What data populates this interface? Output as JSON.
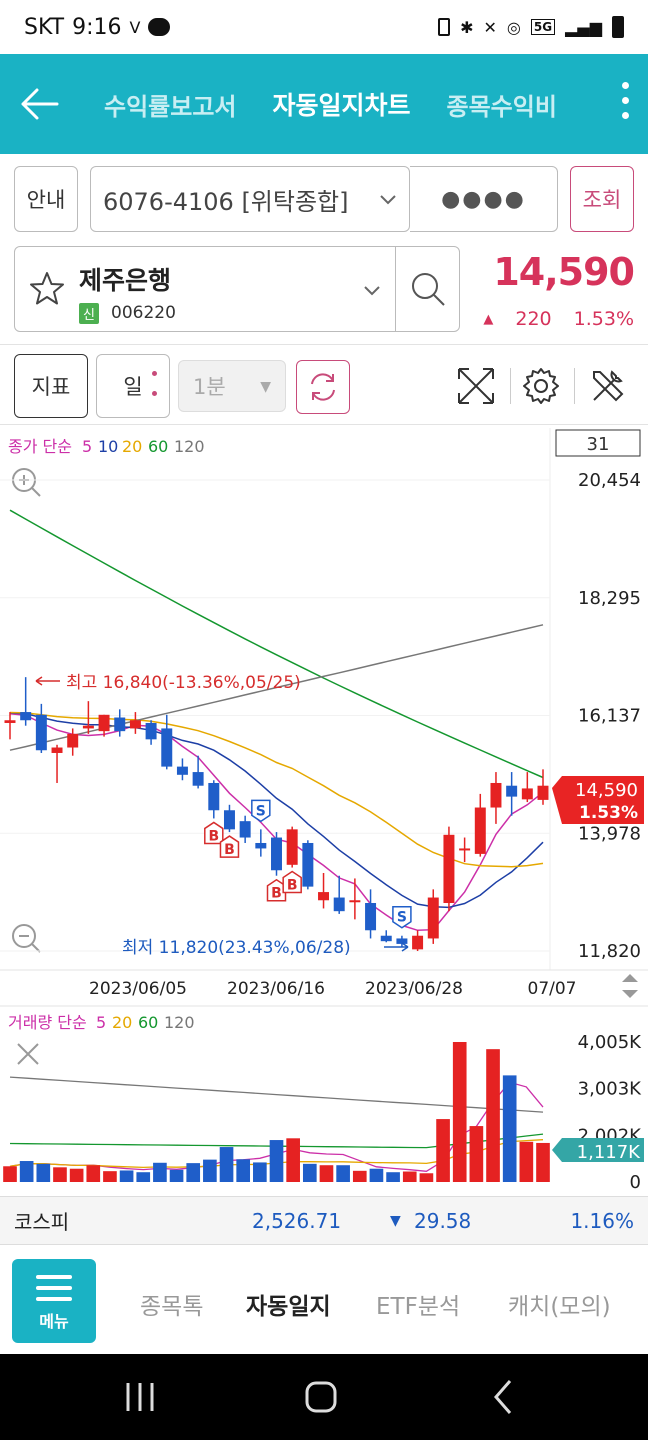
{
  "status": {
    "carrier": "SKT",
    "time": "9:16",
    "network": "5G"
  },
  "nav": {
    "tabs": [
      "수익률보고서",
      "자동일지차트",
      "종목수익비"
    ],
    "active_index": 1
  },
  "account": {
    "info_label": "안내",
    "account_number": "6076-4106 [위탁종합]",
    "password_mask": "●●●●",
    "query_label": "조회"
  },
  "stock": {
    "name": "제주은행",
    "badge": "신",
    "code": "006220",
    "price": "14,590",
    "change": "220",
    "change_pct": "1.53%"
  },
  "toolbar": {
    "indicator_label": "지표",
    "period_label": "일",
    "interval_label": "1분",
    "count": "31"
  },
  "chart_data": {
    "type": "candlestick",
    "legend": {
      "prefix": "종가 단순",
      "periods": [
        "5",
        "10",
        "20",
        "60",
        "120"
      ],
      "colors": [
        "#cc2fa8",
        "#1d3fa6",
        "#e5a800",
        "#14972f",
        "#777777"
      ]
    },
    "y_ticks": [
      "20,454",
      "18,295",
      "16,137",
      "13,978",
      "11,820"
    ],
    "ylim": [
      11820,
      20454
    ],
    "x_ticks": [
      "2023/06/05",
      "2023/06/16",
      "2023/06/28",
      "07/07"
    ],
    "high_label": "최고 16,840(-13.36%,05/25)",
    "low_label": "최저 11,820(23.43%,06/28)",
    "last_price": "14,590",
    "last_pct": "1.53%",
    "candles": [
      {
        "o": 16000,
        "h": 16200,
        "l": 15700,
        "c": 16050
      },
      {
        "o": 16200,
        "h": 16840,
        "l": 15950,
        "c": 16050
      },
      {
        "o": 16150,
        "h": 16350,
        "l": 15450,
        "c": 15500
      },
      {
        "o": 15450,
        "h": 15600,
        "l": 14900,
        "c": 15550
      },
      {
        "o": 15550,
        "h": 15900,
        "l": 15400,
        "c": 15800
      },
      {
        "o": 15900,
        "h": 16400,
        "l": 15800,
        "c": 15950
      },
      {
        "o": 15850,
        "h": 16150,
        "l": 15750,
        "c": 16150
      },
      {
        "o": 16100,
        "h": 16250,
        "l": 15750,
        "c": 15850
      },
      {
        "o": 15900,
        "h": 16200,
        "l": 15800,
        "c": 16050
      },
      {
        "o": 16000,
        "h": 16050,
        "l": 15600,
        "c": 15700
      },
      {
        "o": 15900,
        "h": 16150,
        "l": 15150,
        "c": 15200
      },
      {
        "o": 15200,
        "h": 15350,
        "l": 14950,
        "c": 15050
      },
      {
        "o": 15100,
        "h": 15400,
        "l": 14800,
        "c": 14850
      },
      {
        "o": 14900,
        "h": 14950,
        "l": 14250,
        "c": 14400
      },
      {
        "o": 14400,
        "h": 14500,
        "l": 14000,
        "c": 14050
      },
      {
        "o": 14200,
        "h": 14300,
        "l": 13800,
        "c": 13900
      },
      {
        "o": 13800,
        "h": 14050,
        "l": 13550,
        "c": 13700
      },
      {
        "o": 13900,
        "h": 14000,
        "l": 13200,
        "c": 13300
      },
      {
        "o": 13400,
        "h": 14100,
        "l": 13350,
        "c": 14050
      },
      {
        "o": 13800,
        "h": 13850,
        "l": 12950,
        "c": 13000
      },
      {
        "o": 12750,
        "h": 13250,
        "l": 12600,
        "c": 12900
      },
      {
        "o": 12800,
        "h": 13200,
        "l": 12500,
        "c": 12550
      },
      {
        "o": 12750,
        "h": 13150,
        "l": 12400,
        "c": 12750
      },
      {
        "o": 12700,
        "h": 12950,
        "l": 12050,
        "c": 12200
      },
      {
        "o": 12100,
        "h": 12200,
        "l": 11980,
        "c": 12000
      },
      {
        "o": 12050,
        "h": 12100,
        "l": 11900,
        "c": 11950
      },
      {
        "o": 11850,
        "h": 12200,
        "l": 11820,
        "c": 12100
      },
      {
        "o": 12050,
        "h": 12950,
        "l": 11950,
        "c": 12800
      },
      {
        "o": 12700,
        "h": 14100,
        "l": 12550,
        "c": 13950
      },
      {
        "o": 13700,
        "h": 13900,
        "l": 13450,
        "c": 13700
      },
      {
        "o": 13600,
        "h": 14700,
        "l": 13550,
        "c": 14450
      },
      {
        "o": 14450,
        "h": 15100,
        "l": 14150,
        "c": 14900
      },
      {
        "o": 14850,
        "h": 15100,
        "l": 14300,
        "c": 14650
      },
      {
        "o": 14600,
        "h": 15100,
        "l": 14550,
        "c": 14800
      },
      {
        "o": 14590,
        "h": 15150,
        "l": 14500,
        "c": 14850
      }
    ],
    "signals": [
      {
        "i": 13,
        "type": "B"
      },
      {
        "i": 14,
        "type": "B"
      },
      {
        "i": 16,
        "type": "S"
      },
      {
        "i": 17,
        "type": "B"
      },
      {
        "i": 18,
        "type": "B"
      },
      {
        "i": 25,
        "type": "S"
      }
    ],
    "volume": {
      "legend_prefix": "거래량 단순",
      "periods": [
        "5",
        "20",
        "60",
        "120"
      ],
      "colors": [
        "#cc2fa8",
        "#e5a800",
        "#14972f",
        "#777777"
      ],
      "y_ticks": [
        "4,005K",
        "3,003K",
        "2,002K",
        "0"
      ],
      "ylim": [
        0,
        4005
      ],
      "last_label": "1,117K",
      "values": [
        450,
        600,
        520,
        420,
        380,
        480,
        310,
        330,
        280,
        550,
        350,
        540,
        640,
        1000,
        650,
        560,
        1200,
        1250,
        520,
        480,
        480,
        320,
        380,
        280,
        300,
        250,
        1800,
        4005,
        1600,
        3800,
        3050,
        1150,
        1117
      ]
    }
  },
  "kospi": {
    "label": "코스피",
    "value": "2,526.71",
    "change": "29.58",
    "change_pct": "1.16%"
  },
  "bottom_menu": {
    "menu_label": "메뉴",
    "items": [
      "종목톡",
      "자동일지",
      "ETF분석",
      "캐치(모의)"
    ],
    "active_index": 1
  }
}
